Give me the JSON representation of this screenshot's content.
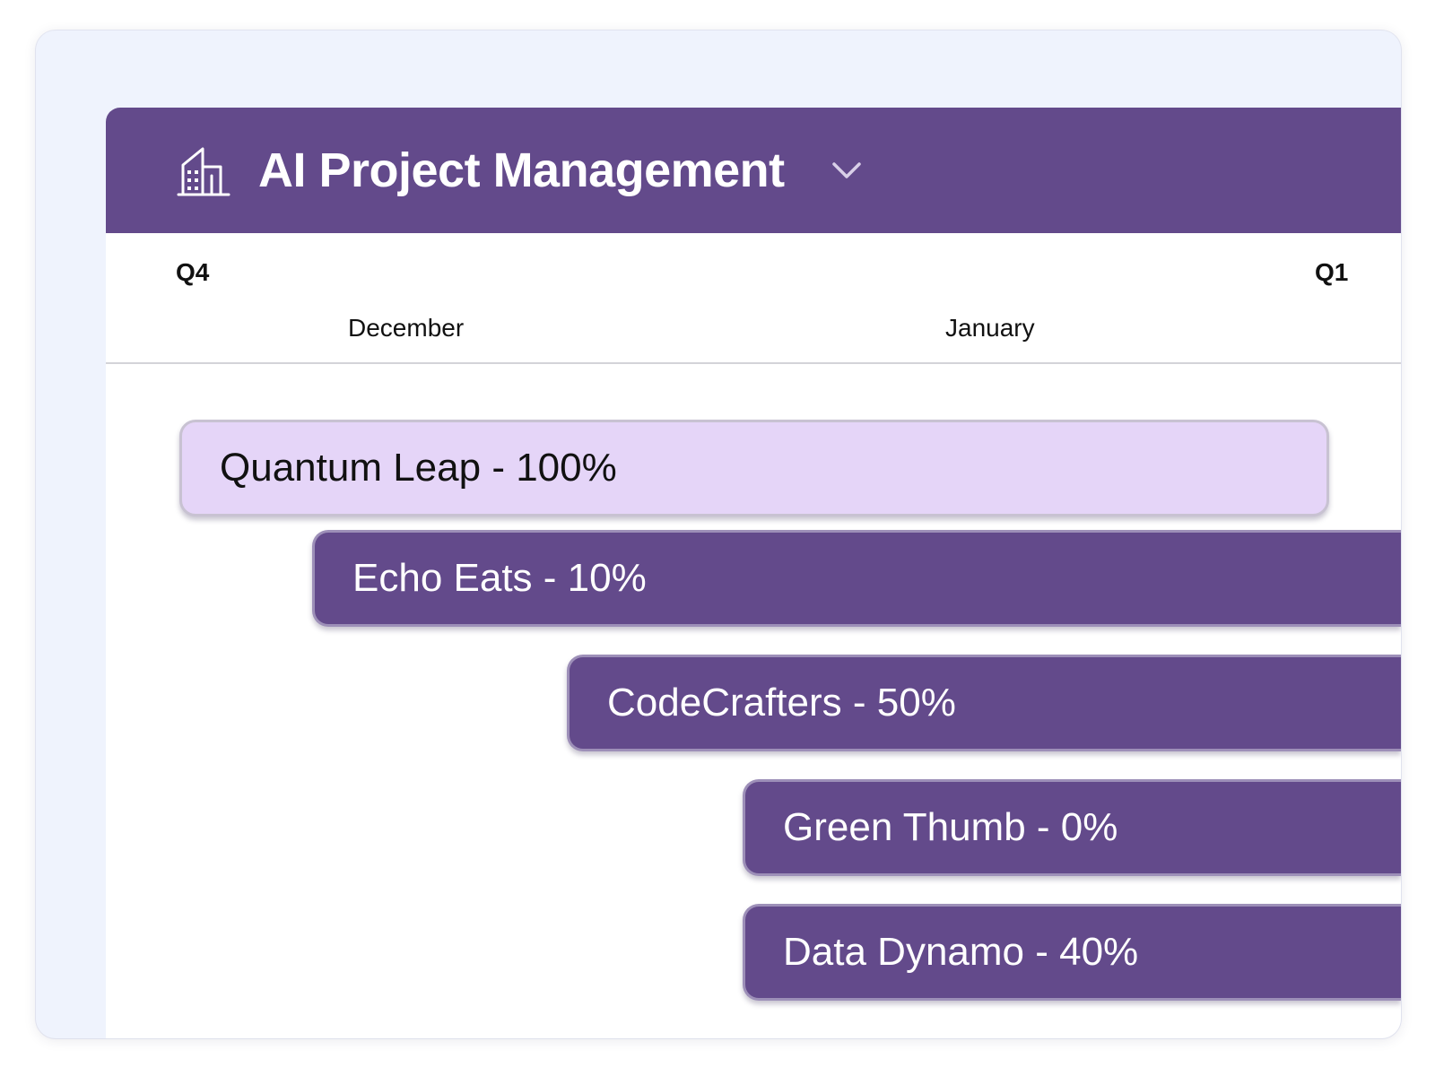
{
  "header": {
    "title": "AI Project Management",
    "icon": "building-icon",
    "dropdown_icon": "chevron-down-icon"
  },
  "timeline": {
    "quarters": [
      {
        "label": "Q4"
      },
      {
        "label": "Q1"
      }
    ],
    "months": [
      {
        "label": "December"
      },
      {
        "label": "January"
      }
    ]
  },
  "projects": [
    {
      "label": "Quantum Leap - 100%",
      "name": "Quantum Leap",
      "progress": 100,
      "status": "complete"
    },
    {
      "label": "Echo Eats - 10%",
      "name": "Echo Eats",
      "progress": 10,
      "status": "active"
    },
    {
      "label": "CodeCrafters - 50%",
      "name": "CodeCrafters",
      "progress": 50,
      "status": "active"
    },
    {
      "label": "Green Thumb - 0%",
      "name": "Green Thumb",
      "progress": 0,
      "status": "active"
    },
    {
      "label": "Data Dynamo - 40%",
      "name": "Data Dynamo",
      "progress": 40,
      "status": "active"
    }
  ],
  "colors": {
    "brand": "#634a8b",
    "complete_bar": "#e5d5f8",
    "background": "#eff3fd"
  }
}
